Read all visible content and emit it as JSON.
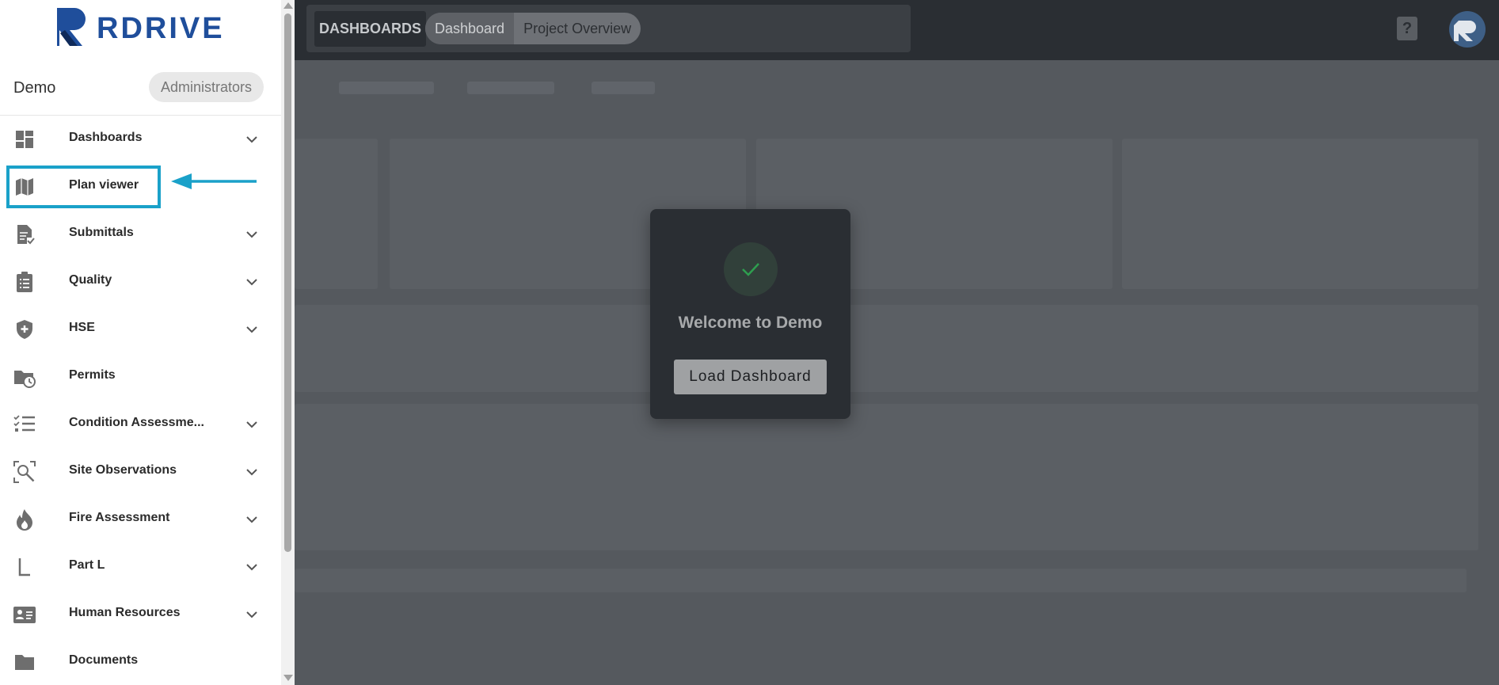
{
  "app": {
    "logo_text": "RDRIVE",
    "brand_color": "#1f4e9b",
    "accent_color": "#1aa1c9"
  },
  "topbar": {
    "section_label": "DASHBOARDS",
    "breadcrumb": {
      "dashboard": "Dashboard",
      "current": "Project Overview"
    },
    "help_label": "?"
  },
  "sidebar": {
    "workspace": "Demo",
    "role": "Administrators",
    "items": [
      {
        "label": "Dashboards",
        "icon": "dashboard-icon",
        "has_children": true
      },
      {
        "label": "Plan viewer",
        "icon": "map-icon",
        "has_children": false,
        "highlighted": true
      },
      {
        "label": "Submittals",
        "icon": "document-check-icon",
        "has_children": true
      },
      {
        "label": "Quality",
        "icon": "clipboard-list-icon",
        "has_children": true
      },
      {
        "label": "HSE",
        "icon": "shield-plus-icon",
        "has_children": true
      },
      {
        "label": "Permits",
        "icon": "folder-clock-icon",
        "has_children": false
      },
      {
        "label": "Condition Assessme...",
        "icon": "checklist-icon",
        "has_children": true
      },
      {
        "label": "Site Observations",
        "icon": "search-scan-icon",
        "has_children": true
      },
      {
        "label": "Fire Assessment",
        "icon": "fire-icon",
        "has_children": true
      },
      {
        "label": "Part L",
        "icon": "part-l-icon",
        "has_children": true
      },
      {
        "label": "Human Resources",
        "icon": "id-card-icon",
        "has_children": true
      },
      {
        "label": "Documents",
        "icon": "folder-icon",
        "has_children": false
      }
    ]
  },
  "modal": {
    "title": "Welcome to Demo",
    "button_label": "Load Dashboard",
    "status_icon": "check-icon",
    "status_color": "#2e9e4f"
  }
}
